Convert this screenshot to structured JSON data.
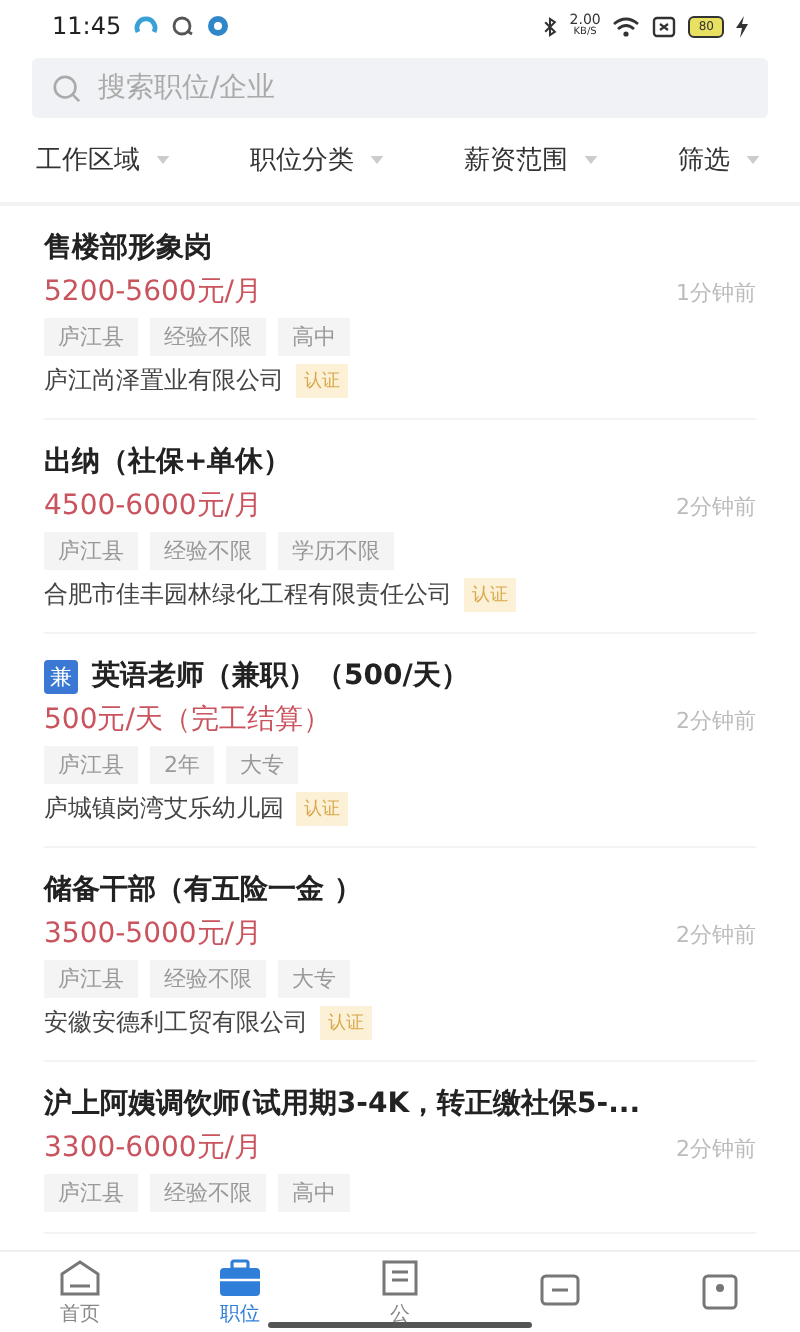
{
  "status_bar": {
    "time": "11:45",
    "speed_value": "2.00",
    "speed_unit": "KB/S",
    "battery": "80"
  },
  "search": {
    "placeholder": "搜索职位/企业"
  },
  "filters": [
    {
      "label": "工作区域"
    },
    {
      "label": "职位分类"
    },
    {
      "label": "薪资范围"
    },
    {
      "label": "筛选"
    }
  ],
  "jobs": [
    {
      "title": "售楼部形象岗",
      "salary": "5200-5600元/月",
      "time": "1分钟前",
      "tags": [
        "庐江县",
        "经验不限",
        "高中"
      ],
      "company": "庐江尚泽置业有限公司",
      "verified": "认证"
    },
    {
      "title": "出纳（社保+单休）",
      "salary": "4500-6000元/月",
      "time": "2分钟前",
      "tags": [
        "庐江县",
        "经验不限",
        "学历不限"
      ],
      "company": "合肥市佳丰园林绿化工程有限责任公司",
      "verified": "认证"
    },
    {
      "title": "英语老师（兼职）（500/天）",
      "badge": "兼",
      "salary": "500元/天（完工结算）",
      "time": "2分钟前",
      "tags": [
        "庐江县",
        "2年",
        "大专"
      ],
      "company": "庐城镇岗湾艾乐幼儿园",
      "verified": "认证"
    },
    {
      "title": "储备干部（有五险一金 ）",
      "salary": "3500-5000元/月",
      "time": "2分钟前",
      "tags": [
        "庐江县",
        "经验不限",
        "大专"
      ],
      "company": "安徽安德利工贸有限公司",
      "verified": "认证"
    },
    {
      "title": "沪上阿姨调饮师(试用期3-4K，转正缴社保5-...",
      "salary": "3300-6000元/月",
      "time": "2分钟前",
      "tags": [
        "庐江县",
        "经验不限",
        "高中"
      ]
    }
  ],
  "nav": [
    {
      "kind": "home",
      "label": "首页",
      "selected": false
    },
    {
      "kind": "job",
      "label": "职位",
      "selected": true
    },
    {
      "kind": "company",
      "label": "公",
      "selected": false
    },
    {
      "kind": "message",
      "selected": false
    },
    {
      "kind": "profile",
      "selected": false
    }
  ]
}
